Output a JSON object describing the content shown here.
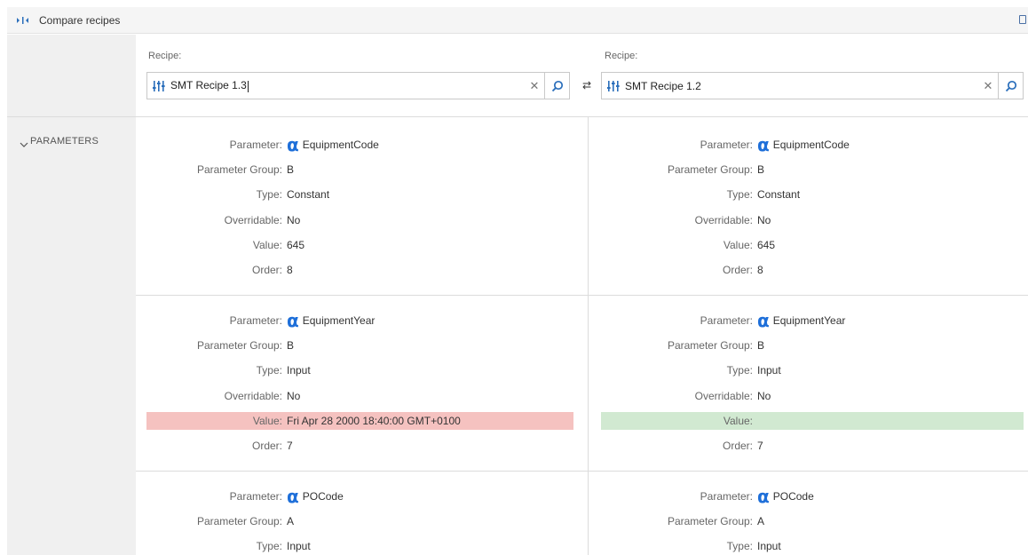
{
  "header": {
    "title": "Compare recipes"
  },
  "left_recipe": {
    "label": "Recipe:",
    "value": "SMT Recipe 1.3"
  },
  "right_recipe": {
    "label": "Recipe:",
    "value": "SMT Recipe 1.2"
  },
  "section": {
    "label": "PARAMETERS"
  },
  "labels": {
    "parameter": "Parameter:",
    "group": "Parameter Group:",
    "type": "Type:",
    "overridable": "Overridable:",
    "value": "Value:",
    "order": "Order:"
  },
  "colors": {
    "accent": "#2a6ebb",
    "diff_left": "#f5c2c0",
    "diff_right": "#d1e9d1"
  },
  "blocks": [
    {
      "left": {
        "parameter": "EquipmentCode",
        "group": "B",
        "type": "Constant",
        "overridable": "No",
        "value": "645",
        "order": "8"
      },
      "right": {
        "parameter": "EquipmentCode",
        "group": "B",
        "type": "Constant",
        "overridable": "No",
        "value": "645",
        "order": "8"
      }
    },
    {
      "left": {
        "parameter": "EquipmentYear",
        "group": "B",
        "type": "Input",
        "overridable": "No",
        "value": "Fri Apr 28 2000 18:40:00 GMT+0100",
        "order": "7"
      },
      "right": {
        "parameter": "EquipmentYear",
        "group": "B",
        "type": "Input",
        "overridable": "No",
        "value": "",
        "order": "7"
      }
    },
    {
      "left": {
        "parameter": "POCode",
        "group": "A",
        "type": "Input"
      },
      "right": {
        "parameter": "POCode",
        "group": "A",
        "type": "Input"
      }
    }
  ]
}
